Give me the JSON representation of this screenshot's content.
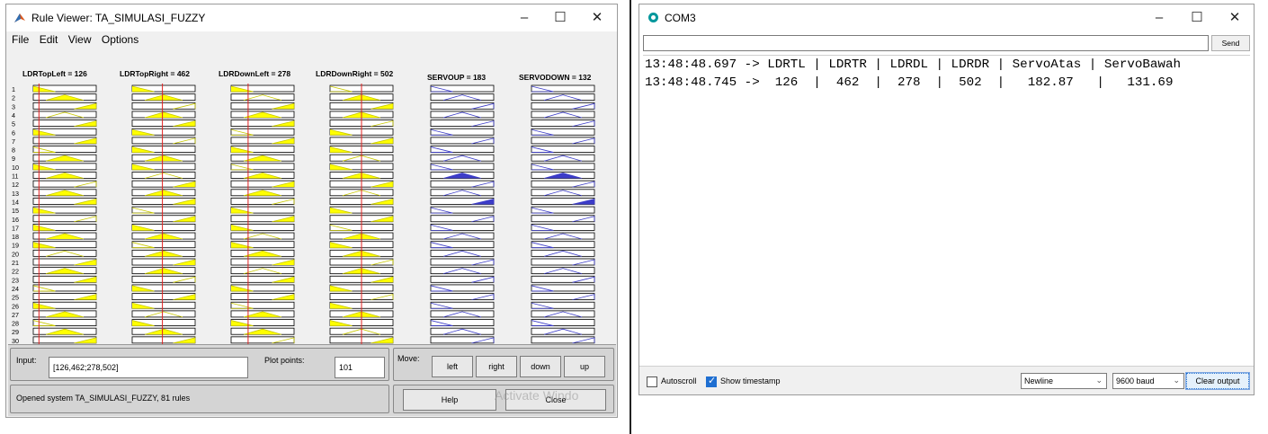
{
  "rule_viewer": {
    "title": "Rule Viewer: TA_SIMULASI_FUZZY",
    "menu": [
      "File",
      "Edit",
      "View",
      "Options"
    ],
    "window_controls": {
      "minimize": "–",
      "maximize": "☐",
      "close": "✕"
    },
    "input_vars": [
      {
        "label": "LDRTopLeft = 126",
        "value_frac": 0.09
      },
      {
        "label": "LDRTopRight = 462",
        "value_frac": 0.48
      },
      {
        "label": "LDRDownLeft = 278",
        "value_frac": 0.27
      },
      {
        "label": "LDRDownRight = 502",
        "value_frac": 0.5
      }
    ],
    "output_vars": [
      {
        "label": "SERVOUP = 183"
      },
      {
        "label": "SERVODOWN = 132"
      }
    ],
    "row_labels": [
      "1",
      "2",
      "3",
      "4",
      "5",
      "6",
      "7",
      "8",
      "9",
      "10",
      "11",
      "12",
      "13",
      "14",
      "15",
      "16",
      "17",
      "18",
      "19",
      "20",
      "21",
      "22",
      "23",
      "24",
      "25",
      "26",
      "27",
      "28",
      "29",
      "30"
    ],
    "input_label": "Input:",
    "input_value": "[126,462;278,502]",
    "plot_points_label": "Plot points:",
    "plot_points_value": "101",
    "move_label": "Move:",
    "move_buttons": [
      "left",
      "right",
      "down",
      "up"
    ],
    "status": "Opened system TA_SIMULASI_FUZZY, 81 rules",
    "help_label": "Help",
    "close_label": "Close",
    "watermark": "Activate Windo"
  },
  "serial_monitor": {
    "title": "COM3",
    "window_controls": {
      "minimize": "–",
      "maximize": "☐",
      "close": "✕"
    },
    "send_label": "Send",
    "lines": [
      "13:48:48.697 -> LDRTL | LDRTR | LDRDL | LDRDR | ServoAtas | ServoBawah",
      "13:48:48.745 ->  126  |  462  |  278  |  502  |   182.87   |   131.69"
    ],
    "autoscroll_label": "Autoscroll",
    "autoscroll_checked": false,
    "timestamp_label": "Show timestamp",
    "timestamp_checked": true,
    "line_ending": "Newline",
    "baud": "9600 baud",
    "clear_label": "Clear output"
  },
  "colors": {
    "mf_fill": "#ffff00",
    "mf_stroke": "#c8c800",
    "out_fill": "#3c3cc8",
    "index_line": "#e02020",
    "accent": "#1f6fd1"
  }
}
